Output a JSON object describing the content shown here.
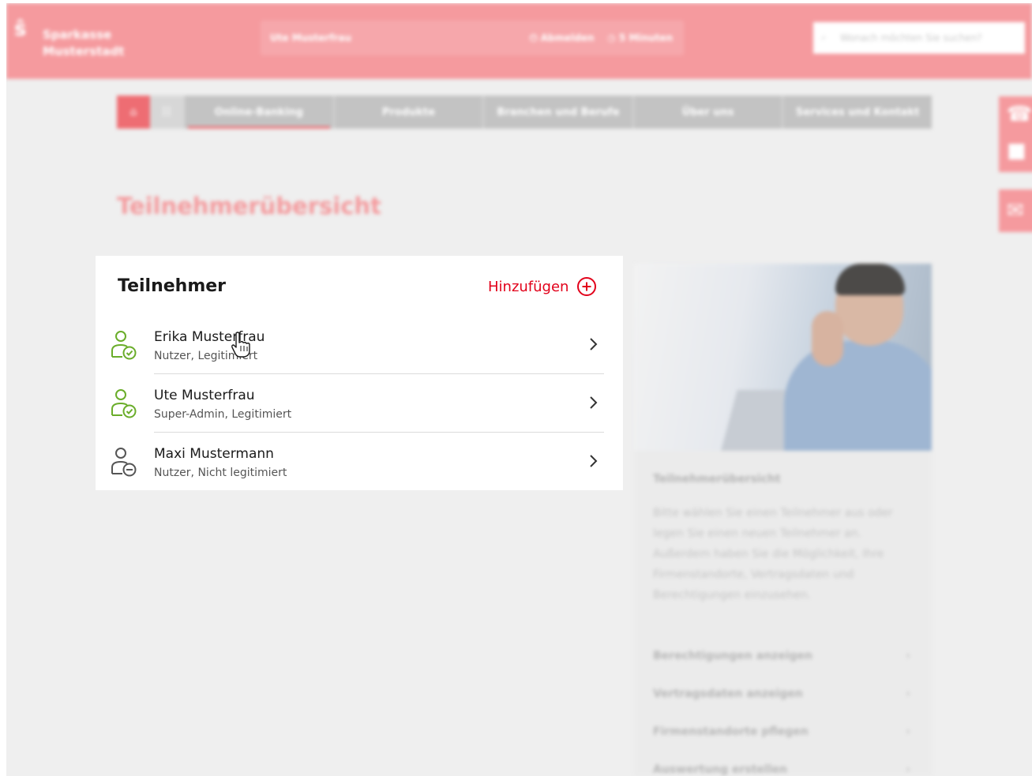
{
  "header": {
    "bank_name_line1": "Sparkasse",
    "bank_name_line2": "Musterstadt",
    "logo_glyph": "ŝ",
    "user_name": "Ute Musterfrau",
    "logout_label": "⏻ Abmelden",
    "timer_label": "◷ 5 Minuten",
    "search_placeholder": "Wonach möchten Sie suchen?",
    "search_icon_glyph": "⌕"
  },
  "nav": {
    "home_glyph": "⌂",
    "grid_glyph": "☷",
    "tabs": [
      {
        "label": "Online-Banking"
      },
      {
        "label": "Produkte"
      },
      {
        "label": "Branchen und Berufe"
      },
      {
        "label": "Über uns"
      },
      {
        "label": "Services und Kontakt"
      }
    ]
  },
  "side_contact": {
    "phone_glyph": "☎",
    "chat_glyph": "✉"
  },
  "page": {
    "title": "Teilnehmerübersicht"
  },
  "participants": {
    "heading": "Teilnehmer",
    "add_label": "Hinzufügen",
    "items": [
      {
        "name": "Erika Musterfrau",
        "role": "Nutzer, Legitimiert",
        "status_icon": "user-verified-icon"
      },
      {
        "name": "Ute Musterfrau",
        "role": "Super-Admin, Legitimiert",
        "status_icon": "user-verified-icon"
      },
      {
        "name": "Maxi Mustermann",
        "role": "Nutzer, Nicht legitimiert",
        "status_icon": "user-unverified-icon"
      }
    ]
  },
  "info": {
    "title": "Teilnehmerübersicht",
    "text": "Bitte wählen Sie einen Teilnehmer aus oder legen Sie einen neuen Teilnehmer an. Außerdem haben Sie die Möglichkeit, Ihre Firmenstandorte, Vertragsdaten und Berechtigungen einzusehen.",
    "links": [
      {
        "label": "Berechtigungen anzeigen"
      },
      {
        "label": "Vertragsdaten anzeigen"
      },
      {
        "label": "Firmenstandorte pflegen"
      },
      {
        "label": "Auswertung erstellen"
      }
    ],
    "chevron_glyph": "›"
  },
  "colors": {
    "brand_red": "#e2001a",
    "verified_green": "#6aad2a",
    "unverified_gray": "#555555"
  }
}
